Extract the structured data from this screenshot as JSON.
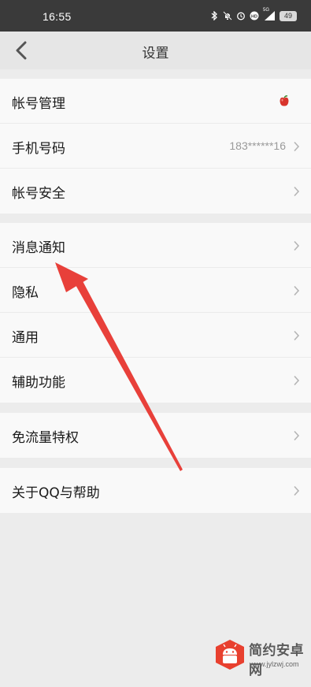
{
  "status_bar": {
    "time": "16:55",
    "icons": [
      "bluetooth-icon",
      "mute-icon",
      "alarm-icon",
      "hd-icon",
      "signal-5g-icon"
    ],
    "network": "5G",
    "battery": "49"
  },
  "nav": {
    "back_icon": "chevron-left-icon",
    "title": "设置"
  },
  "groups": [
    {
      "rows": [
        {
          "label": "帐号管理",
          "value": "",
          "trailing_icon": "apple-icon"
        },
        {
          "label": "手机号码",
          "value": "183******16",
          "trailing_icon": "chevron-right-icon"
        },
        {
          "label": "帐号安全",
          "value": "",
          "trailing_icon": "chevron-right-icon"
        }
      ]
    },
    {
      "rows": [
        {
          "label": "消息通知",
          "value": "",
          "trailing_icon": "chevron-right-icon"
        },
        {
          "label": "隐私",
          "value": "",
          "trailing_icon": "chevron-right-icon"
        },
        {
          "label": "通用",
          "value": "",
          "trailing_icon": "chevron-right-icon"
        },
        {
          "label": "辅助功能",
          "value": "",
          "trailing_icon": "chevron-right-icon"
        }
      ]
    },
    {
      "rows": [
        {
          "label": "免流量特权",
          "value": "",
          "trailing_icon": "chevron-right-icon"
        }
      ]
    },
    {
      "rows": [
        {
          "label": "关于QQ与帮助",
          "value": "",
          "trailing_icon": "chevron-right-icon"
        }
      ]
    }
  ],
  "annotation": {
    "type": "red-arrow",
    "points_to": "消息通知",
    "color": "#e8403a"
  },
  "watermark": {
    "title": "简约安卓网",
    "url": "www.jylzwj.com"
  },
  "colors": {
    "status_bar": "#3a3a3a",
    "nav_bar": "#e6e6e6",
    "background": "#ececec",
    "row_background": "#f9f9f9",
    "label_text": "#1a1a1a",
    "secondary_text": "#9a9a9a"
  }
}
